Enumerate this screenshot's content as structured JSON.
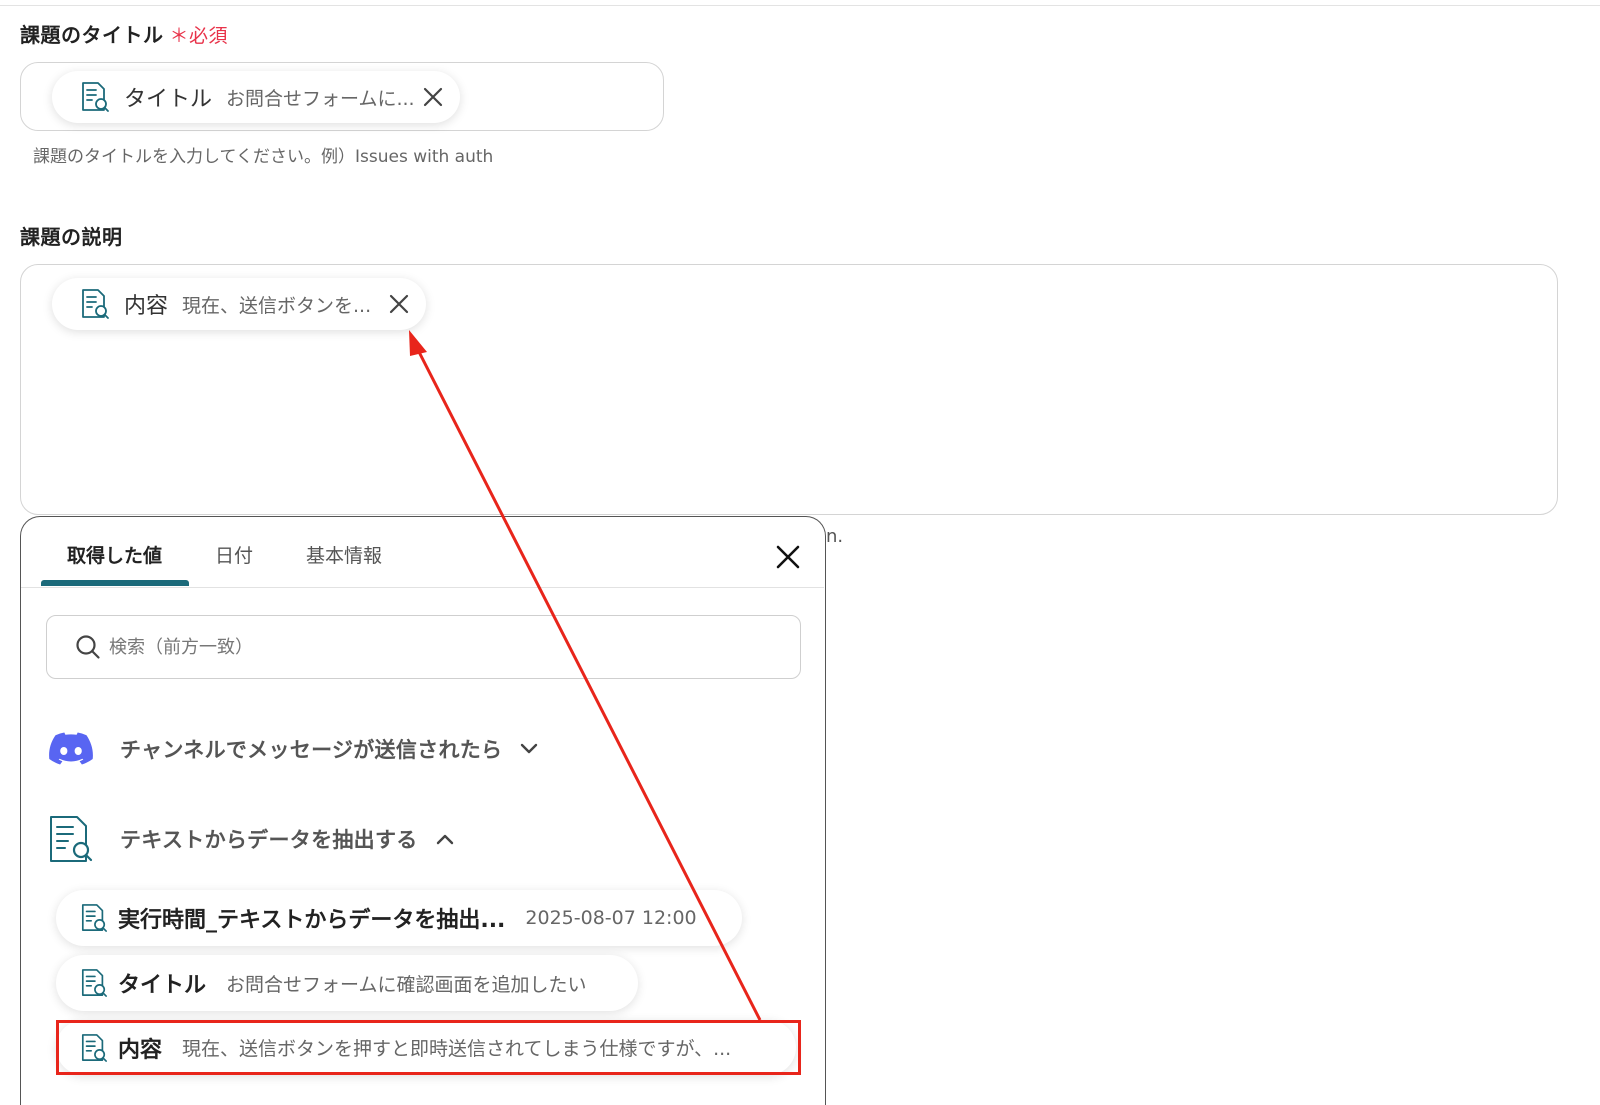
{
  "title_field": {
    "label": "課題のタイトル",
    "required_mark": "＊必須",
    "chip": {
      "name": "タイトル",
      "value": "お問合せフォームに..."
    },
    "hint": "課題のタイトルを入力してください。例）Issues with auth"
  },
  "description_field": {
    "label": "課題の説明",
    "chip": {
      "name": "内容",
      "value": "現在、送信ボタンを..."
    },
    "hint_fragment": "n."
  },
  "picker": {
    "tabs": [
      {
        "label": "取得した値",
        "active": true
      },
      {
        "label": "日付",
        "active": false
      },
      {
        "label": "基本情報",
        "active": false
      }
    ],
    "search_placeholder": "検索（前方一致）",
    "sections": [
      {
        "label": "チャンネルでメッセージが送信されたら",
        "icon": "discord-icon",
        "expanded": false
      },
      {
        "label": "テキストからデータを抽出する",
        "icon": "document-search-icon",
        "expanded": true
      }
    ],
    "items": [
      {
        "name": "実行時間_テキストからデータを抽出...",
        "value": "2025-08-07 12:00"
      },
      {
        "name": "タイトル",
        "value": "お問合せフォームに確認画面を追加したい"
      },
      {
        "name": "内容",
        "value": "現在、送信ボタンを押すと即時送信されてしまう仕様ですが、...",
        "highlighted": true
      }
    ]
  },
  "colors": {
    "accent_teal": "#1b6a7a",
    "required_red": "#e8334a",
    "annotation_red": "#e8251b",
    "discord_blurple": "#5865f2"
  }
}
